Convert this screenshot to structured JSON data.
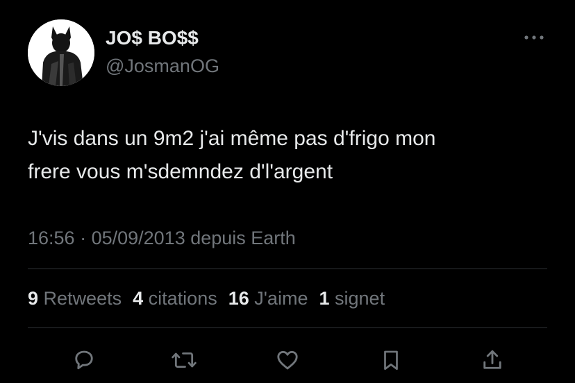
{
  "author": {
    "display_name": "JO$ BO$$",
    "handle": "@JosmanOG",
    "avatar_icon": "masked-figure-avatar"
  },
  "tweet": {
    "text_lines": [
      "J'vis dans un 9m2 j'ai même pas d'frigo mon",
      "frere vous m'sdemndez d'l'argent"
    ],
    "time": "16:56",
    "separator": " · ",
    "date": "05/09/2013",
    "source": " depuis Earth"
  },
  "stats": {
    "retweets": {
      "count": "9",
      "label": "Retweets"
    },
    "quotes": {
      "count": "4",
      "label": "citations"
    },
    "likes": {
      "count": "16",
      "label": "J'aime"
    },
    "bookmarks": {
      "count": "1",
      "label": "signet"
    }
  },
  "actions": [
    "reply-icon",
    "retweet-icon",
    "like-icon",
    "bookmark-icon",
    "share-icon"
  ],
  "colors": {
    "background": "#000000",
    "primary_text": "#e7e9ea",
    "secondary_text": "#71767b",
    "divider": "#2f3336"
  }
}
